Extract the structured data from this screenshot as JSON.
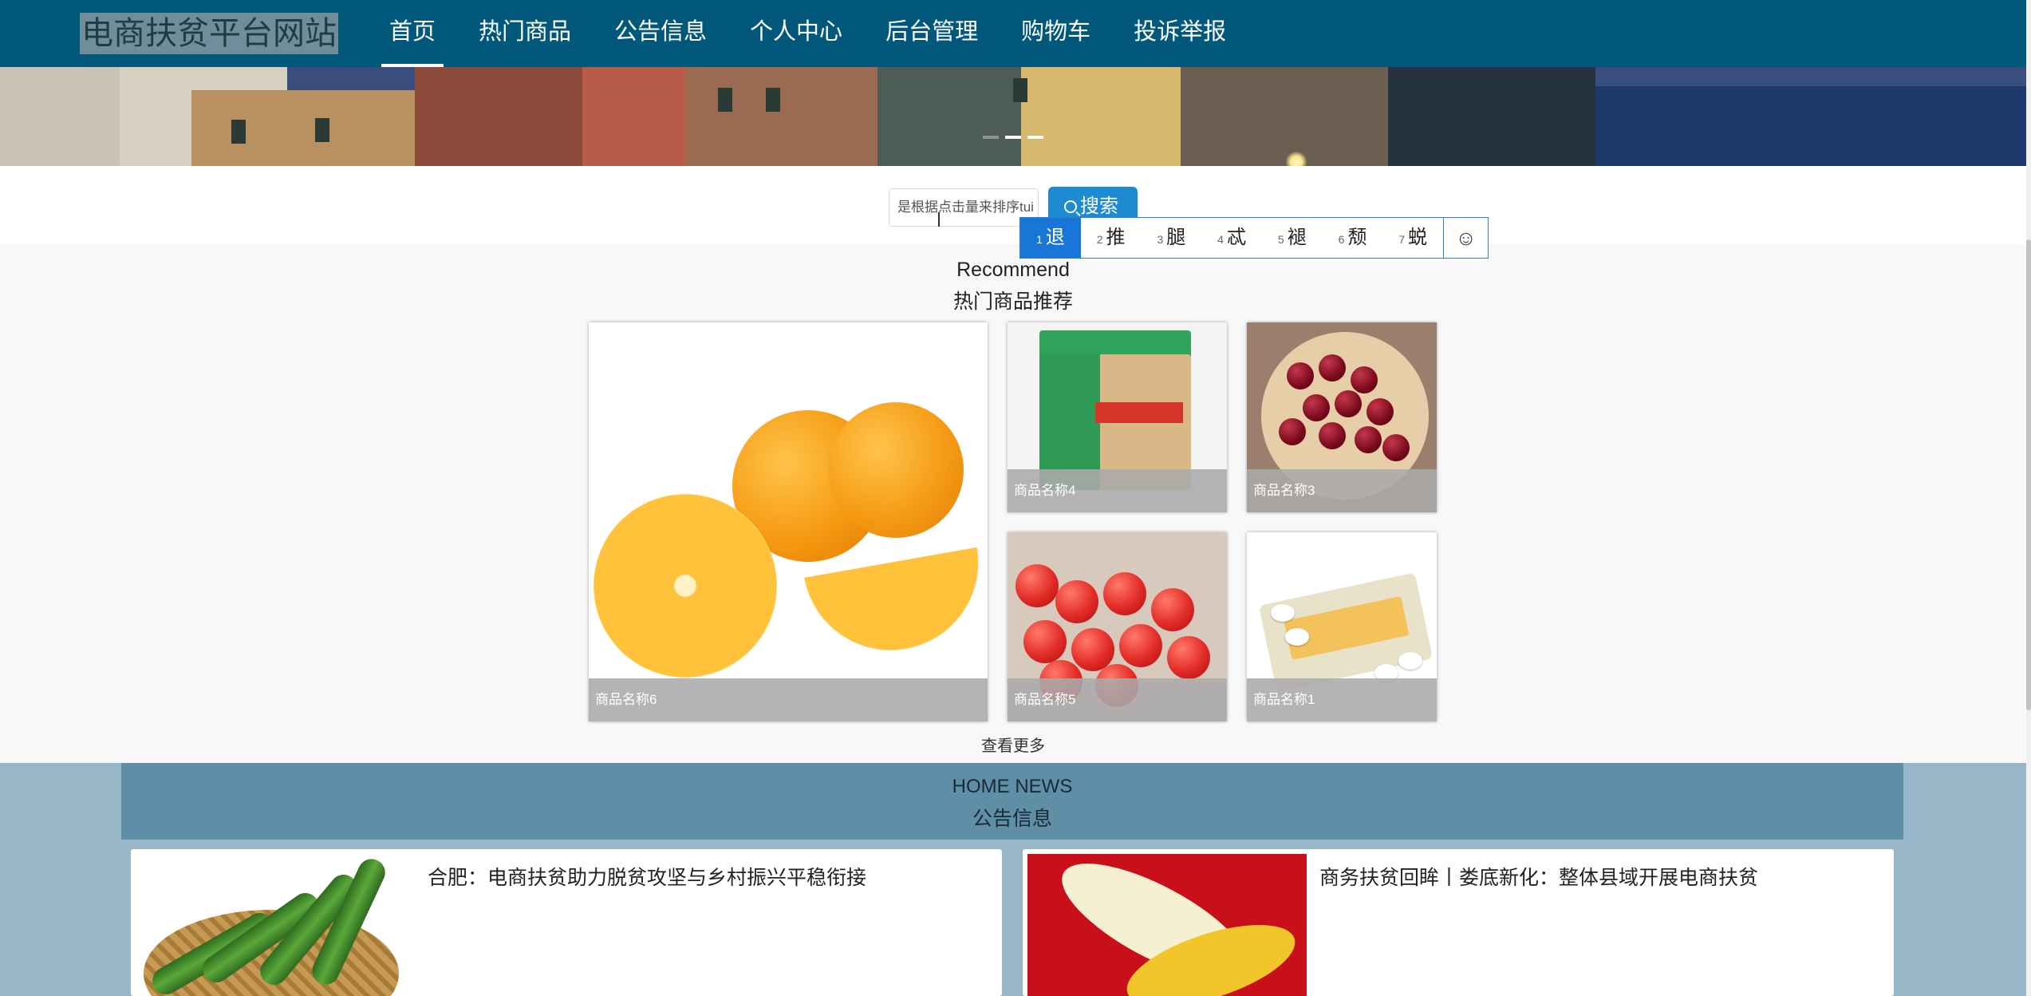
{
  "site": {
    "brand": "电商扶贫平台网站"
  },
  "nav": {
    "items": [
      {
        "label": "首页",
        "active": true
      },
      {
        "label": "热门商品"
      },
      {
        "label": "公告信息"
      },
      {
        "label": "个人中心"
      },
      {
        "label": "后台管理"
      },
      {
        "label": "购物车"
      },
      {
        "label": "投诉举报"
      }
    ]
  },
  "search": {
    "input_value": "是根据点击量来排序tui",
    "button_label": "搜索"
  },
  "ime": {
    "candidates": [
      {
        "index": "1",
        "text": "退",
        "selected": true
      },
      {
        "index": "2",
        "text": "推"
      },
      {
        "index": "3",
        "text": "腿"
      },
      {
        "index": "4",
        "text": "忒"
      },
      {
        "index": "5",
        "text": "褪"
      },
      {
        "index": "6",
        "text": "颓"
      },
      {
        "index": "7",
        "text": "蜕"
      }
    ],
    "emoji_glyph": "☺"
  },
  "recommend": {
    "title_en": "Recommend",
    "title_cn": "热门商品推荐",
    "products": [
      {
        "name": "商品名称6"
      },
      {
        "name": "商品名称4"
      },
      {
        "name": "商品名称3"
      },
      {
        "name": "商品名称5"
      },
      {
        "name": "商品名称1"
      }
    ],
    "more_label": "查看更多"
  },
  "news": {
    "title_en": "HOME NEWS",
    "title_cn": "公告信息",
    "items": [
      {
        "title": "合肥：电商扶贫助力脱贫攻坚与乡村振兴平稳衔接"
      },
      {
        "title": "商务扶贫回眸丨娄底新化：整体县域开展电商扶贫"
      }
    ]
  },
  "colors": {
    "nav_bg": "#01587b",
    "accent": "#1e8bd1",
    "news_bg": "#97b7c9",
    "news_head": "#5f8ea7"
  }
}
